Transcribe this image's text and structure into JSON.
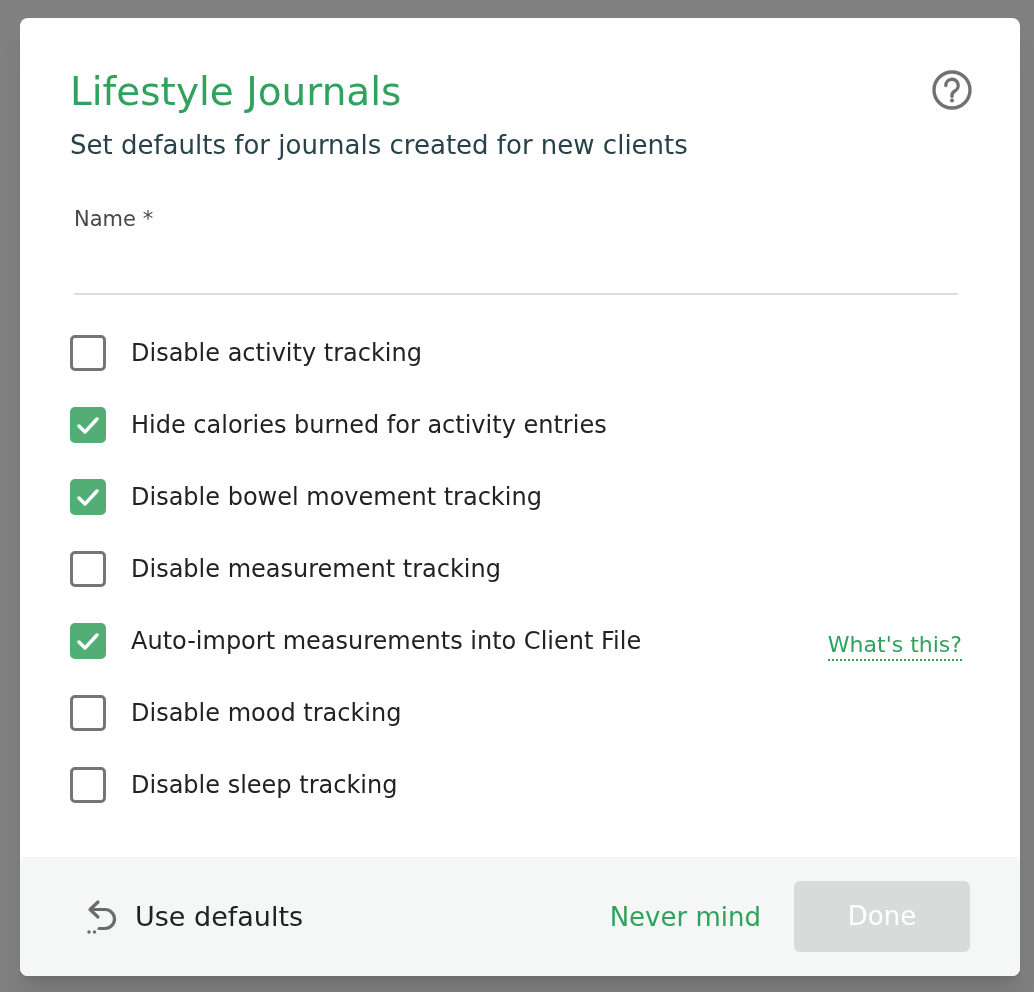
{
  "dialog": {
    "title": "Lifestyle Journals",
    "subtitle": "Set defaults for journals created for new clients"
  },
  "name_field": {
    "label": "Name *"
  },
  "options": [
    {
      "label": "Disable activity tracking",
      "checked": false
    },
    {
      "label": "Hide calories burned for activity entries",
      "checked": true
    },
    {
      "label": "Disable bowel movement tracking",
      "checked": true
    },
    {
      "label": "Disable measurement tracking",
      "checked": false
    },
    {
      "label": "Auto-import measurements into Client File",
      "checked": true,
      "link": "What's this?"
    },
    {
      "label": "Disable mood tracking",
      "checked": false
    },
    {
      "label": "Disable sleep tracking",
      "checked": false
    }
  ],
  "footer": {
    "reset": "Use defaults",
    "cancel": "Never mind",
    "confirm": {
      "label": "Done",
      "disabled": true
    }
  }
}
